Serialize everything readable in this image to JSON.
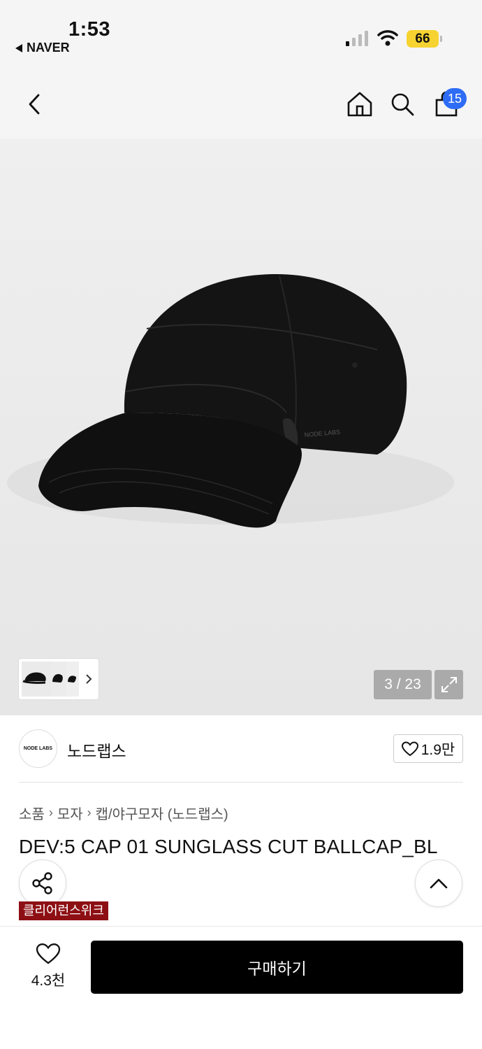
{
  "status_bar": {
    "time": "1:53",
    "back_app": "NAVER",
    "battery": "66"
  },
  "header": {
    "cart_count": "15"
  },
  "gallery": {
    "counter": "3 / 23",
    "hat_logo": "NODE LABS"
  },
  "brand": {
    "logo_text": "NODE LABS",
    "name": "노드랩스",
    "likes": "1.9만"
  },
  "breadcrumb": [
    "소품",
    "모자",
    "캡/야구모자 (노드랩스)"
  ],
  "product": {
    "title": "DEV:5 CAP 01 SUNGLASS CUT BALLCAP_BL",
    "tag": "클리어런스위크"
  },
  "bottom_bar": {
    "wish_count": "4.3천",
    "buy_label": "구매하기"
  },
  "colors": {
    "badge_blue": "#2e6cf6",
    "tag_red": "#8d0f14",
    "battery_yellow": "#f7d331"
  }
}
